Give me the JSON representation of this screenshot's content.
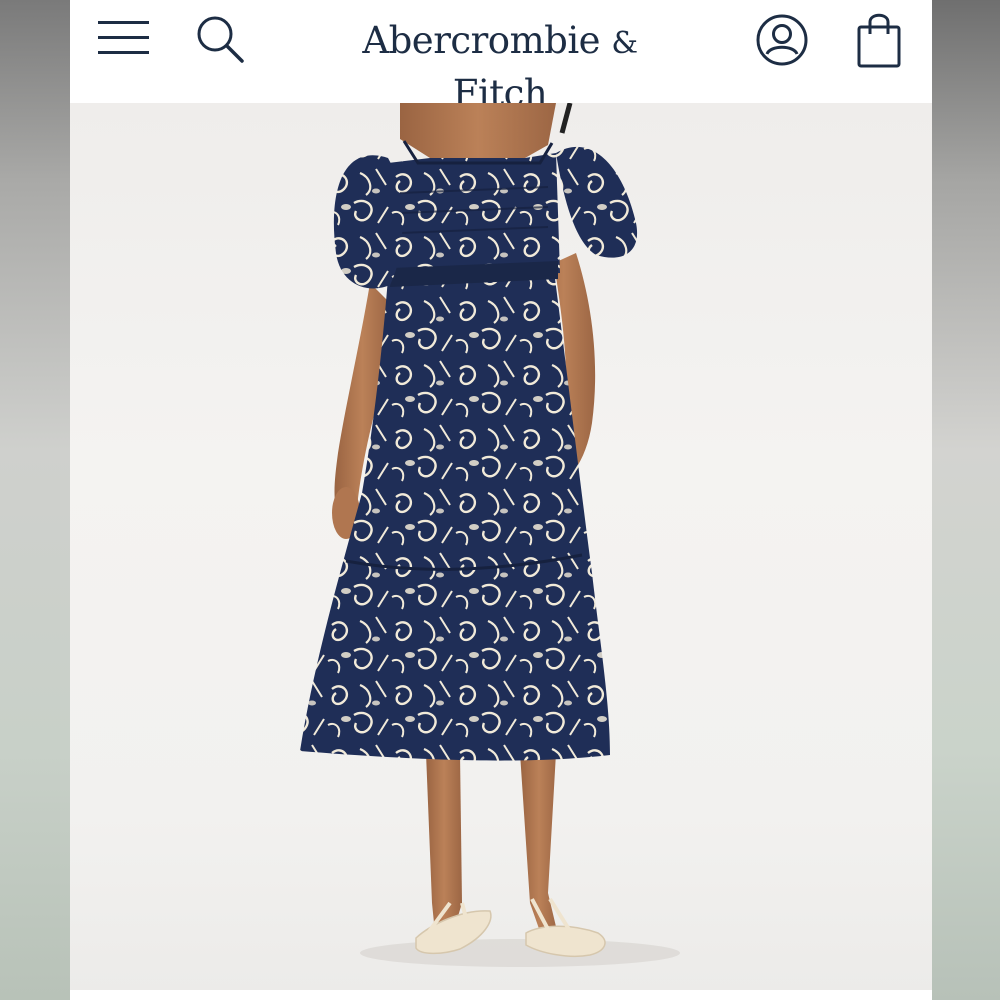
{
  "header": {
    "brand_name": "Abercrombie",
    "brand_amp": "&",
    "brand_suffix": "Fitch",
    "icons": {
      "menu": "hamburger-menu-icon",
      "search": "search-icon",
      "account": "account-icon",
      "bag": "shopping-bag-icon"
    }
  },
  "colors": {
    "brand_navy": "#1d2d44",
    "dress_navy": "#1f2e57",
    "print_cream": "#f1ead9",
    "skin": "#b47a52",
    "sandal": "#efe4cf"
  }
}
